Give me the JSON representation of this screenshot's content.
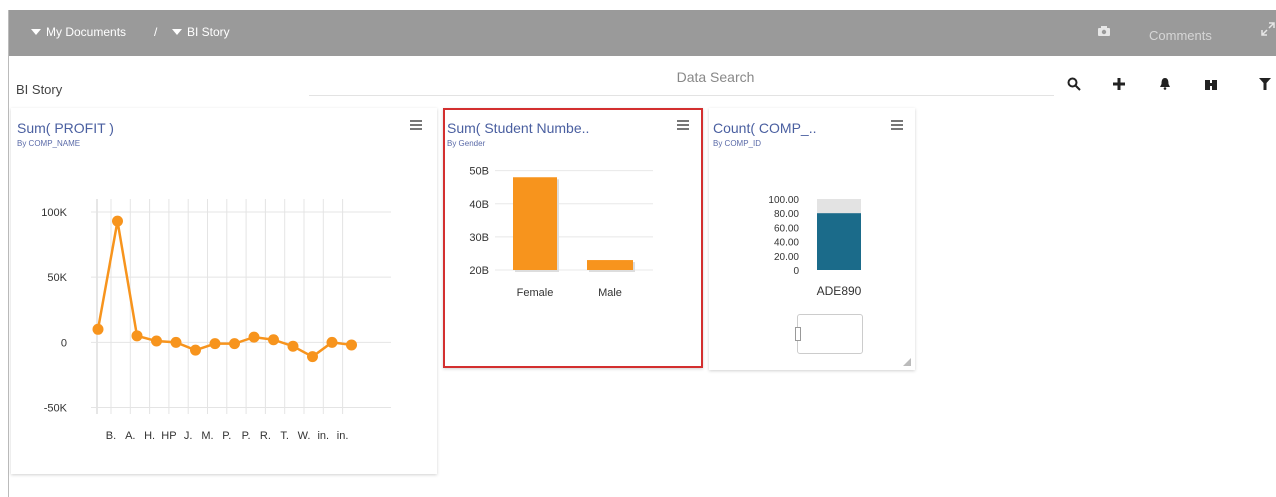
{
  "breadcrumb": {
    "root": "My Documents",
    "separator": "/",
    "current": "BI Story"
  },
  "header": {
    "comments_label": "Comments"
  },
  "story": {
    "title": "BI Story"
  },
  "search": {
    "placeholder": "Data Search"
  },
  "cards": {
    "profit": {
      "title": "Sum( PROFIT )",
      "subtitle": "By COMP_NAME",
      "chart_data": {
        "type": "line",
        "categories": [
          "B.",
          "A.",
          "H.",
          "HP",
          "J.",
          "M.",
          "P.",
          "P.",
          "R.",
          "T.",
          "W.",
          "in.",
          "in."
        ],
        "values": [
          10000,
          93000,
          5000,
          1000,
          0,
          -6000,
          -1000,
          -1000,
          4000,
          2000,
          -3000,
          -11000,
          0,
          -2000
        ],
        "y_ticks": [
          "100K",
          "50K",
          "0",
          "-50K"
        ],
        "y_tick_values": [
          100000,
          50000,
          0,
          -50000
        ],
        "ylim": [
          -55000,
          110000
        ],
        "color": "#f7941d"
      }
    },
    "students": {
      "title": "Sum( Student Numbe..",
      "subtitle": "By Gender",
      "chart_data": {
        "type": "bar",
        "categories": [
          "Female",
          "Male"
        ],
        "values": [
          48,
          23
        ],
        "y_ticks": [
          "50B",
          "40B",
          "30B",
          "20B"
        ],
        "y_tick_values": [
          50,
          40,
          30,
          20
        ],
        "ylim": [
          20,
          52
        ],
        "color": "#f7941d"
      }
    },
    "count": {
      "title": "Count( COMP_..",
      "subtitle": "By COMP_ID",
      "chart_data": {
        "type": "bar",
        "categories": [
          "ADE890"
        ],
        "values": [
          80
        ],
        "y_ticks": [
          "100.00",
          "80.00",
          "60.00",
          "40.00",
          "20.00",
          "0"
        ],
        "y_tick_values": [
          100,
          80,
          60,
          40,
          20,
          0
        ],
        "ylim": [
          0,
          100
        ],
        "color": "#1b6b8a"
      }
    }
  }
}
